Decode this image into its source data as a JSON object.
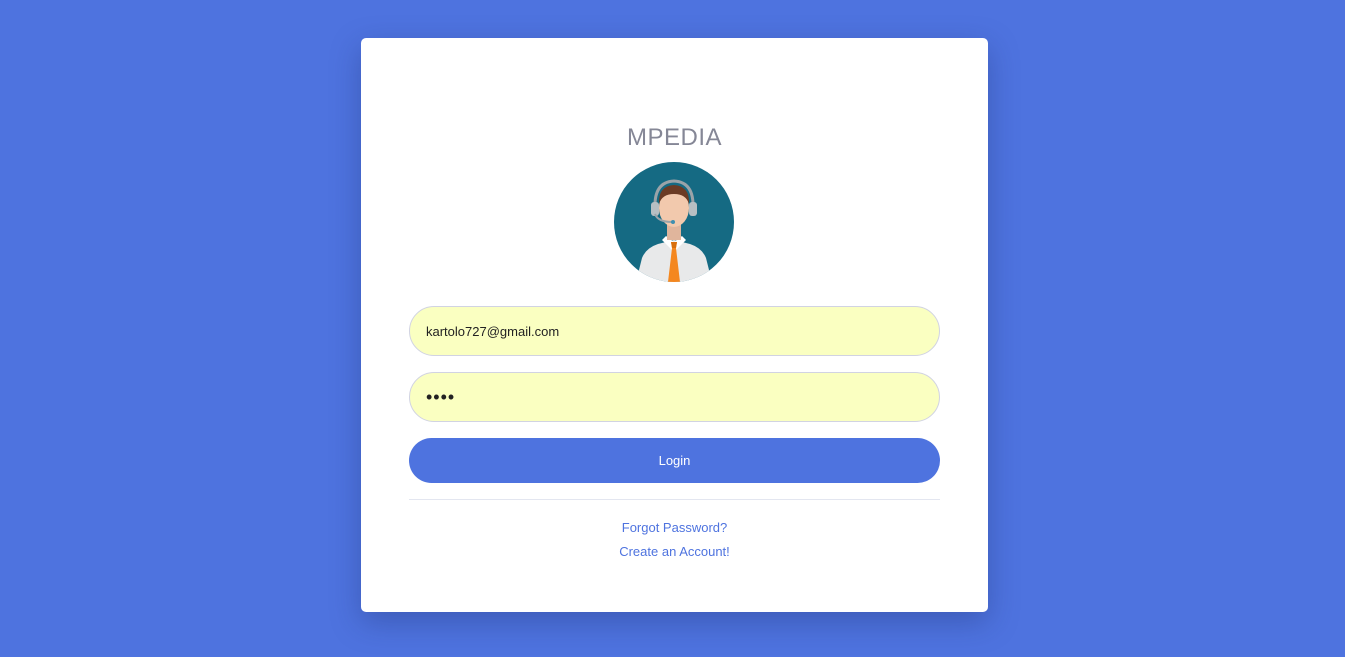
{
  "login": {
    "brand": "MPEDIA",
    "avatar_icon": "customer-support-agent-icon",
    "email_value": "kartolo727@gmail.com",
    "password_value": "1234",
    "login_label": "Login",
    "forgot_link": "Forgot Password?",
    "create_link": "Create an Account!"
  },
  "colors": {
    "background": "#4e73df",
    "primary": "#4e73df",
    "input_autofill": "#faffc1",
    "brand_text": "#858796",
    "avatar_circle": "#156a83"
  }
}
